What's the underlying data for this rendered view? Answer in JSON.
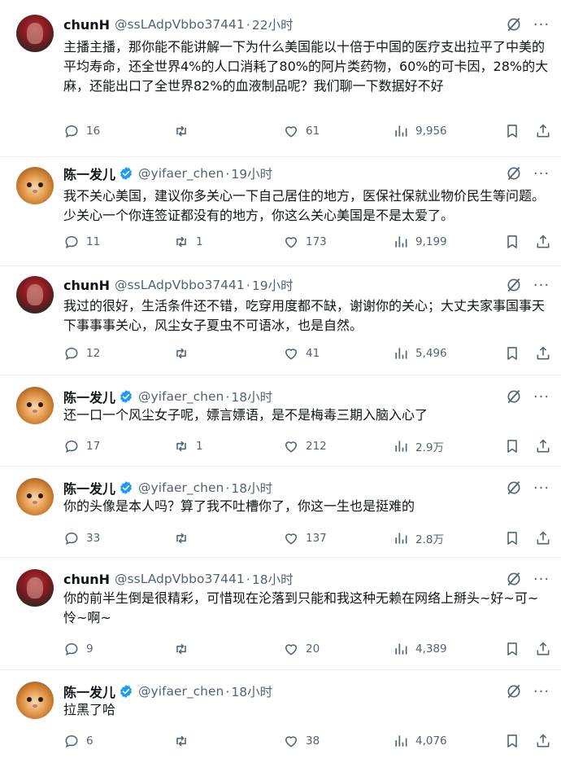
{
  "tweets": [
    {
      "avatar": "red-portrait",
      "name": "chunH",
      "verified": false,
      "handle": "@ssLAdpVbbo37441",
      "dot": "·",
      "time": "22小时",
      "body": "主播主播，那你能不能讲解一下为什么美国能以十倍于中国的医疗支出拉平了中美的平均寿命，还全世界4%的人口消耗了80%的阿片类药物，60%的可卡因，28%的大麻，还能出口了全世界82%的血液制品呢？我们聊一下数据好不好",
      "replies": "16",
      "retweets": "",
      "likes": "61",
      "views": "9,956"
    },
    {
      "avatar": "orange-cat",
      "name": "陈一发儿",
      "verified": true,
      "handle": "@yifaer_chen",
      "dot": "·",
      "time": "19小时",
      "body": "我不关心美国，建议你多关心一下自己居住的地方，医保社保就业物价民生等问题。少关心一个你连签证都没有的地方，你这么关心美国是不是太爱了。",
      "replies": "11",
      "retweets": "1",
      "likes": "173",
      "views": "9,199"
    },
    {
      "avatar": "red-portrait",
      "name": "chunH",
      "verified": false,
      "handle": "@ssLAdpVbbo37441",
      "dot": "·",
      "time": "19小时",
      "body": "我过的很好，生活条件还不错，吃穿用度都不缺，谢谢你的关心；大丈夫家事国事天下事事事关心，风尘女子夏虫不可语冰，也是自然。",
      "replies": "12",
      "retweets": "",
      "likes": "41",
      "views": "5,496"
    },
    {
      "avatar": "orange-cat",
      "name": "陈一发儿",
      "verified": true,
      "handle": "@yifaer_chen",
      "dot": "·",
      "time": "18小时",
      "body": "还一口一个风尘女子呢，嫖言嫖语，是不是梅毒三期入脑入心了",
      "replies": "17",
      "retweets": "1",
      "likes": "212",
      "views": "2.9万"
    },
    {
      "avatar": "orange-cat",
      "name": "陈一发儿",
      "verified": true,
      "handle": "@yifaer_chen",
      "dot": "·",
      "time": "18小时",
      "body": "你的头像是本人吗？算了我不吐槽你了，你这一生也是挺难的",
      "replies": "33",
      "retweets": "",
      "likes": "137",
      "views": "2.8万"
    },
    {
      "avatar": "red-portrait",
      "name": "chunH",
      "verified": false,
      "handle": "@ssLAdpVbbo37441",
      "dot": "·",
      "time": "18小时",
      "body": "你的前半生倒是很精彩，可惜现在沦落到只能和我这种无赖在网络上掰头~好~可~怜~啊~",
      "replies": "9",
      "retweets": "",
      "likes": "20",
      "views": "4,389"
    },
    {
      "avatar": "orange-cat",
      "name": "陈一发儿",
      "verified": true,
      "handle": "@yifaer_chen",
      "dot": "·",
      "time": "18小时",
      "body": "拉黑了哈",
      "replies": "6",
      "retweets": "",
      "likes": "38",
      "views": "4,076"
    }
  ],
  "icons": {
    "reply": "reply-icon",
    "retweet": "retweet-icon",
    "like": "heart-icon",
    "views": "views-chart-icon",
    "bookmark": "bookmark-icon",
    "share": "share-icon",
    "grok": "grok-icon",
    "more": "more-icon",
    "verified": "verified-badge-icon"
  },
  "colors": {
    "text": "#0f1419",
    "secondary": "#536471",
    "verified": "#1d9bf0",
    "divider": "#eff3f4"
  }
}
